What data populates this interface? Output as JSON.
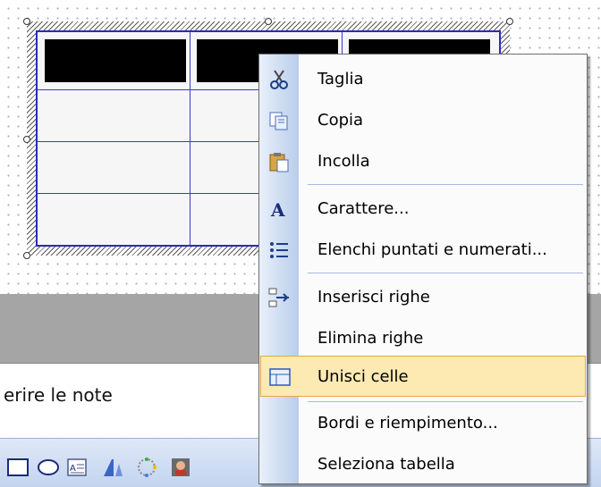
{
  "context_menu": {
    "items": [
      {
        "label": "Taglia",
        "icon": "scissors-icon"
      },
      {
        "label": "Copia",
        "icon": "copy-icon"
      },
      {
        "label": "Incolla",
        "icon": "paste-icon"
      },
      {
        "label": "Carattere...",
        "icon": "font-icon"
      },
      {
        "label": "Elenchi puntati e numerati...",
        "icon": "bullets-numbering-icon"
      },
      {
        "label": "Inserisci righe",
        "icon": "insert-rows-icon"
      },
      {
        "label": "Elimina righe",
        "icon": null
      },
      {
        "label": "Unisci celle",
        "icon": "merge-cells-icon"
      },
      {
        "label": "Bordi e riempimento...",
        "icon": null
      },
      {
        "label": "Seleziona tabella",
        "icon": null
      }
    ],
    "highlighted_item": "Unisci celle"
  },
  "notes_pane": {
    "visible_text": "erire le note"
  },
  "drawing_toolbar": {
    "icons": [
      "rectangle-icon",
      "oval-icon",
      "text-box-icon",
      "wordart-icon",
      "diagram-icon",
      "clip-art-icon"
    ]
  },
  "colors": {
    "table_border": "#2b2bb8",
    "header_cells": "#000000",
    "menu_highlight": "#fde9b2",
    "menu_highlight_border": "#e2a84a",
    "band": "#a5a5a5"
  }
}
